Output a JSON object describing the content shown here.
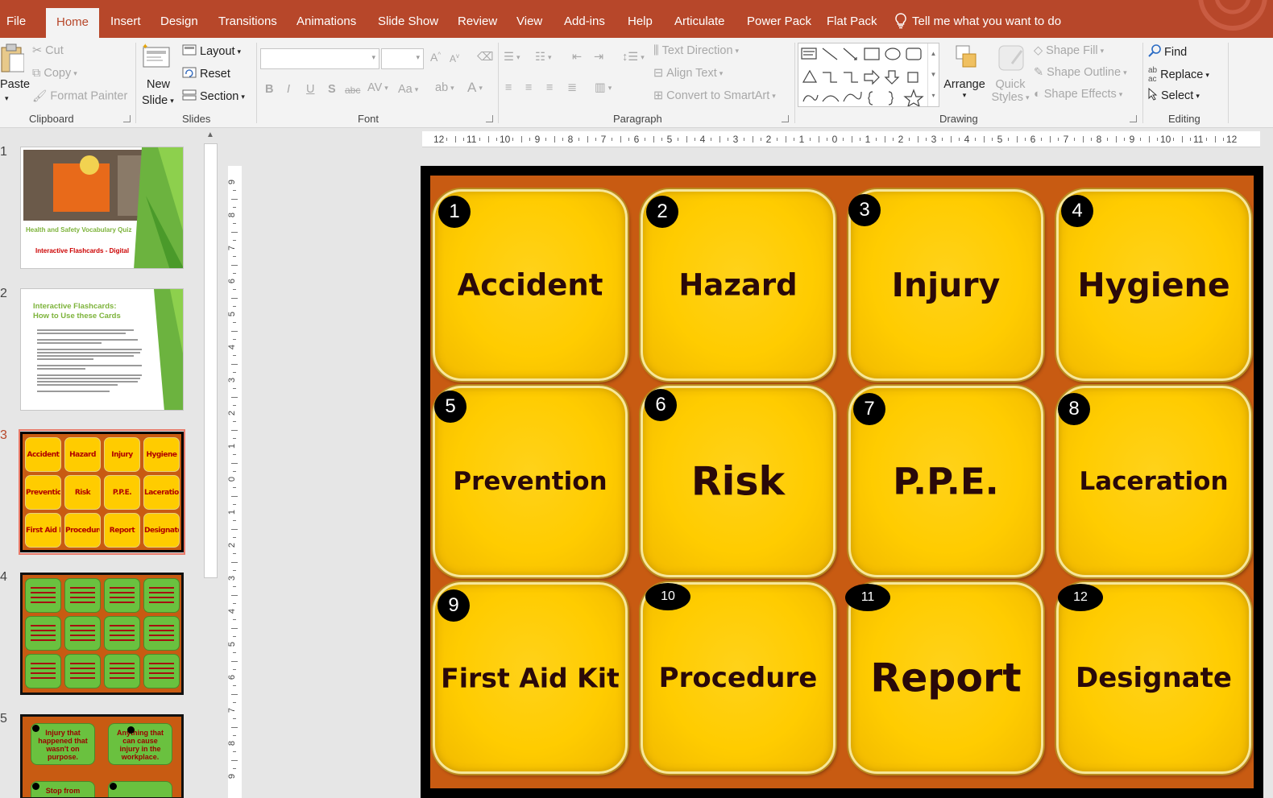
{
  "menubar": {
    "items": [
      "File",
      "Home",
      "Insert",
      "Design",
      "Transitions",
      "Animations",
      "Slide Show",
      "Review",
      "View",
      "Add-ins",
      "Help",
      "Articulate",
      "Power Pack",
      "Flat Pack"
    ],
    "tell_me": "Tell me what you want to do"
  },
  "ribbon": {
    "clipboard": {
      "label": "Clipboard",
      "paste": "Paste",
      "cut": "Cut",
      "copy": "Copy",
      "format_painter": "Format Painter"
    },
    "slides": {
      "label": "Slides",
      "new_slide_1": "New",
      "new_slide_2": "Slide",
      "layout": "Layout",
      "reset": "Reset",
      "section": "Section"
    },
    "font": {
      "label": "Font",
      "font_name": "",
      "font_size": ""
    },
    "paragraph": {
      "label": "Paragraph",
      "text_direction": "Text Direction",
      "align_text": "Align Text",
      "convert_smartart": "Convert to SmartArt"
    },
    "drawing": {
      "label": "Drawing",
      "arrange": "Arrange",
      "quick_styles_1": "Quick",
      "quick_styles_2": "Styles",
      "shape_fill": "Shape Fill",
      "shape_outline": "Shape Outline",
      "shape_effects": "Shape Effects"
    },
    "editing": {
      "label": "Editing",
      "find": "Find",
      "replace": "Replace",
      "select": "Select"
    }
  },
  "thumbnails": {
    "numbers": [
      "1",
      "2",
      "3",
      "4",
      "5"
    ],
    "slide1": {
      "title": "Health and Safety Vocabulary Quiz",
      "subtitle": "Interactive Flashcards - Digital"
    },
    "slide2": {
      "title_1": "Interactive Flashcards:",
      "title_2": "How to Use these Cards"
    },
    "slide5": {
      "card1": "Injury that happened that wasn't on purpose.",
      "card2": "Anything that can cause injury in the workplace.",
      "card3": "Stop from"
    }
  },
  "ruler": {
    "h_ticks": [
      "12",
      "11",
      "10",
      "9",
      "8",
      "7",
      "6",
      "5",
      "4",
      "3",
      "2",
      "1",
      "0",
      "1",
      "2",
      "3",
      "4",
      "5",
      "6",
      "7",
      "8",
      "9",
      "10",
      "11",
      "12"
    ],
    "v_ticks": [
      "9",
      "8",
      "7",
      "6",
      "5",
      "4",
      "3",
      "2",
      "1",
      "0",
      "1",
      "2",
      "3",
      "4",
      "5",
      "6",
      "7",
      "8",
      "9"
    ]
  },
  "slide": {
    "cards": [
      {
        "num": "1",
        "word": "Accident"
      },
      {
        "num": "2",
        "word": "Hazard"
      },
      {
        "num": "3",
        "word": "Injury"
      },
      {
        "num": "4",
        "word": "Hygiene"
      },
      {
        "num": "5",
        "word": "Prevention"
      },
      {
        "num": "6",
        "word": "Risk"
      },
      {
        "num": "7",
        "word": "P.P.E."
      },
      {
        "num": "8",
        "word": "Laceration"
      },
      {
        "num": "9",
        "word": "First Aid Kit"
      },
      {
        "num": "10",
        "word": "Procedure"
      },
      {
        "num": "11",
        "word": "Report"
      },
      {
        "num": "12",
        "word": "Designate"
      }
    ]
  },
  "colors": {
    "accent": "#b7472a",
    "card": "#ffcc00",
    "slide_bg": "#c85b12",
    "text_dark": "#2a0909"
  }
}
